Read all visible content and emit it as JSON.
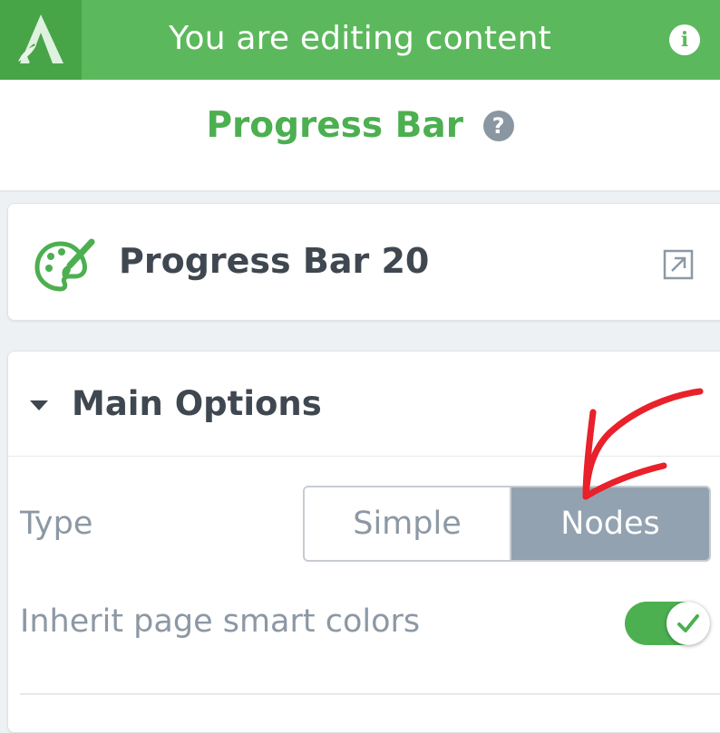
{
  "header": {
    "title": "You are editing content",
    "logo_icon": "leaf-a-logo-icon",
    "info_icon": "info-icon",
    "info_glyph": "i",
    "bg_color": "#5cb85c",
    "logo_bg_color": "#47a548"
  },
  "panel": {
    "title": "Progress Bar",
    "help_icon": "question-mark-icon",
    "help_glyph": "?",
    "title_color": "#4caf50"
  },
  "element": {
    "name": "Progress Bar 20",
    "icon": "palette-brush-icon",
    "open_icon": "open-external-icon"
  },
  "main_options": {
    "title": "Main Options",
    "expanded": true,
    "type": {
      "label": "Type",
      "options": [
        "Simple",
        "Nodes"
      ],
      "selected": "Nodes",
      "selected_color": "#93a2b0"
    },
    "inherit_colors": {
      "label": "Inherit page smart colors",
      "enabled": true,
      "toggle_color": "#4caf50"
    }
  },
  "annotation": {
    "shape": "hand-drawn-red-arrow",
    "color": "#e8212a",
    "points_to": "Nodes"
  }
}
